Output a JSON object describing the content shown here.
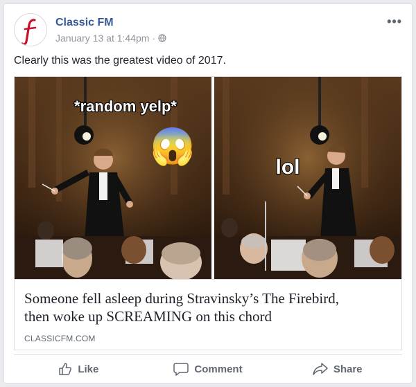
{
  "post": {
    "page_name": "Classic FM",
    "timestamp": "January 13 at 1:44pm",
    "separator": "·",
    "privacy_icon": "globe-icon",
    "text": "Clearly this was the greatest video of 2017.",
    "avatar_icon": "classicfm-logo-icon",
    "more_label": "•••"
  },
  "media": {
    "left_caption": "*random yelp*",
    "right_caption": "lol",
    "emoji": "😱"
  },
  "link": {
    "title_line1": "Someone fell asleep during Stravinsky’s The Firebird,",
    "title_line2": "then woke up SCREAMING on this chord",
    "domain": "CLASSICFM.COM"
  },
  "actions": {
    "like": "Like",
    "comment": "Comment",
    "share": "Share"
  },
  "colors": {
    "brand_red": "#c8102e",
    "name_blue": "#365899",
    "muted": "#90949c"
  }
}
